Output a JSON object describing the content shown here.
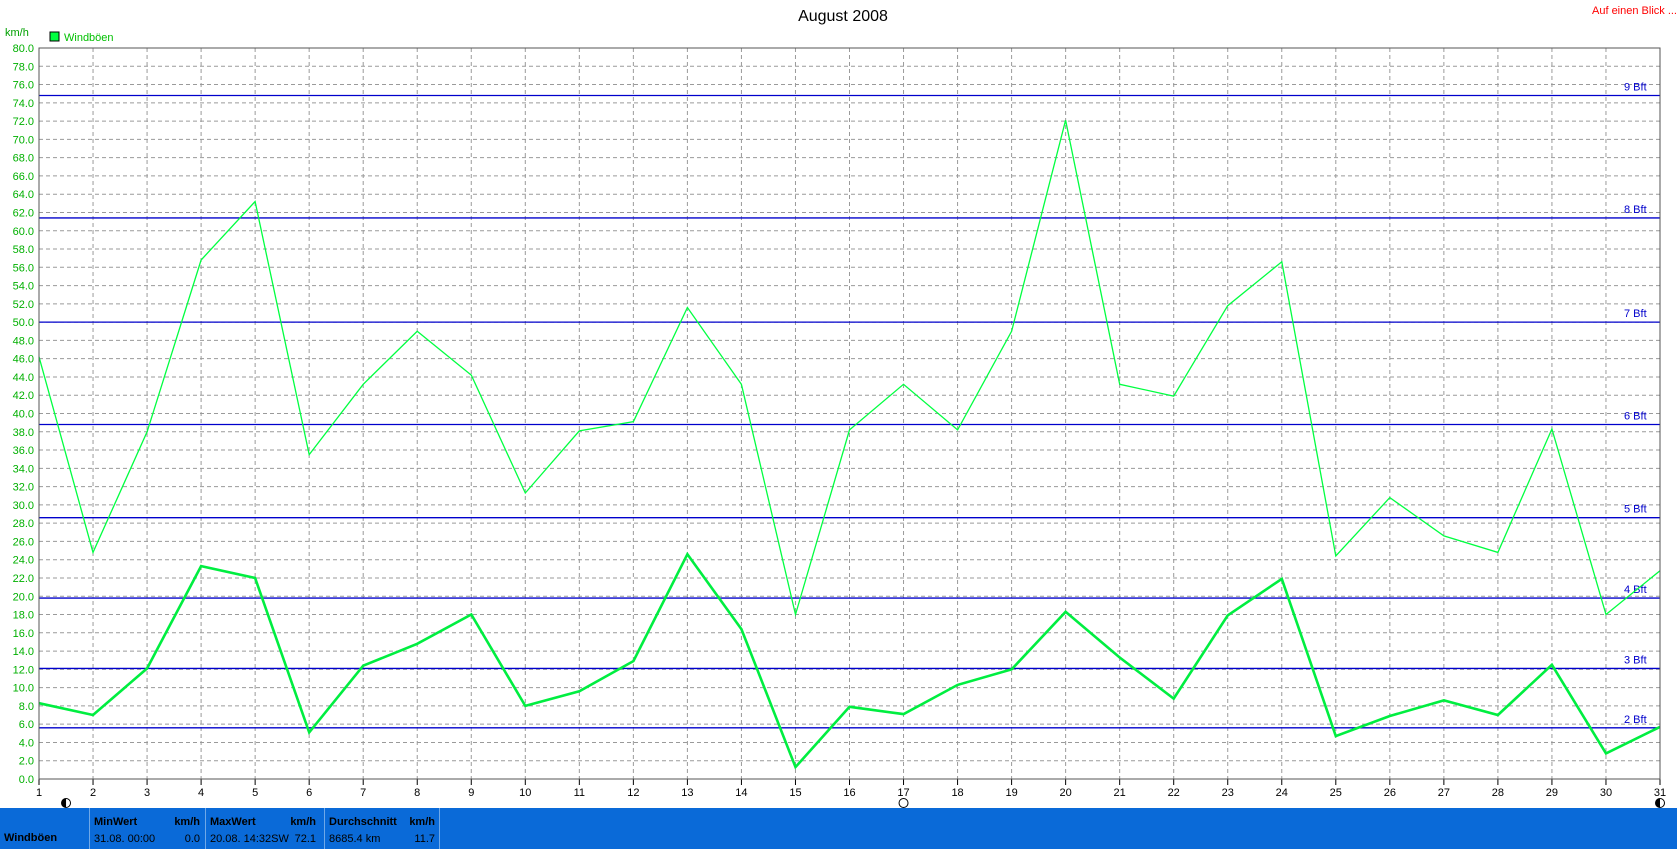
{
  "header": {
    "title": "August 2008",
    "link": "Auf einen Blick ..."
  },
  "chart_data": {
    "type": "line",
    "title": "August 2008",
    "ylabel": "km/h",
    "xlabel": "",
    "x": [
      1,
      2,
      3,
      4,
      5,
      6,
      7,
      8,
      9,
      10,
      11,
      12,
      13,
      14,
      15,
      16,
      17,
      18,
      19,
      20,
      21,
      22,
      23,
      24,
      25,
      26,
      27,
      28,
      29,
      30,
      31
    ],
    "xlim": [
      1,
      31
    ],
    "ylim": [
      0,
      80
    ],
    "ytick_step": 2,
    "grid": true,
    "legend_position": "top-left",
    "legend": [
      "Windböen"
    ],
    "series": [
      {
        "name": "Windböen",
        "style": "thin",
        "color": "#00ff40",
        "values": [
          46.2,
          24.8,
          38.0,
          56.8,
          63.2,
          35.5,
          43.2,
          49.0,
          44.2,
          31.3,
          38.1,
          39.1,
          51.6,
          43.2,
          18.0,
          38.2,
          43.2,
          38.2,
          49.0,
          72.1,
          43.2,
          41.9,
          51.8,
          56.6,
          24.4,
          30.8,
          26.6,
          24.8,
          38.3,
          18.0,
          22.8
        ]
      },
      {
        "style": "thick",
        "color": "#00ee40",
        "values": [
          8.3,
          7.0,
          12.1,
          23.3,
          22.0,
          5.1,
          12.4,
          14.8,
          18.0,
          8.0,
          9.6,
          12.9,
          24.6,
          16.4,
          1.3,
          7.9,
          7.1,
          10.3,
          12.0,
          18.3,
          13.3,
          8.8,
          17.9,
          21.9,
          4.7,
          6.9,
          8.6,
          7.0,
          12.5,
          2.8,
          5.7
        ]
      }
    ],
    "reference_lines": [
      {
        "label": "9 Bft",
        "value": 74.8
      },
      {
        "label": "8 Bft",
        "value": 61.4
      },
      {
        "label": "7 Bft",
        "value": 50.0
      },
      {
        "label": "6 Bft",
        "value": 38.8
      },
      {
        "label": "5 Bft",
        "value": 28.6
      },
      {
        "label": "4 Bft",
        "value": 19.8
      },
      {
        "label": "3 Bft",
        "value": 12.1
      },
      {
        "label": "2 Bft",
        "value": 5.6
      }
    ],
    "reference_color": "#0000cc",
    "moon_phases": [
      {
        "x": 1.5,
        "icon": "half-moon-icon"
      },
      {
        "x": 17,
        "icon": "full-moon-icon"
      },
      {
        "x": 31,
        "icon": "half-moon-icon"
      }
    ]
  },
  "stats": {
    "label": "Windböen",
    "boxes": [
      {
        "head": "MinWert",
        "unit": "km/h",
        "left": "31.08.  00:00",
        "right": "0.0"
      },
      {
        "head": "MaxWert",
        "unit": "km/h",
        "left": "20.08.  14:32SW",
        "right": "72.1"
      },
      {
        "head": "Durchschnitt",
        "unit": "km/h",
        "left": "8685.4 km",
        "right": "11.7"
      }
    ]
  }
}
